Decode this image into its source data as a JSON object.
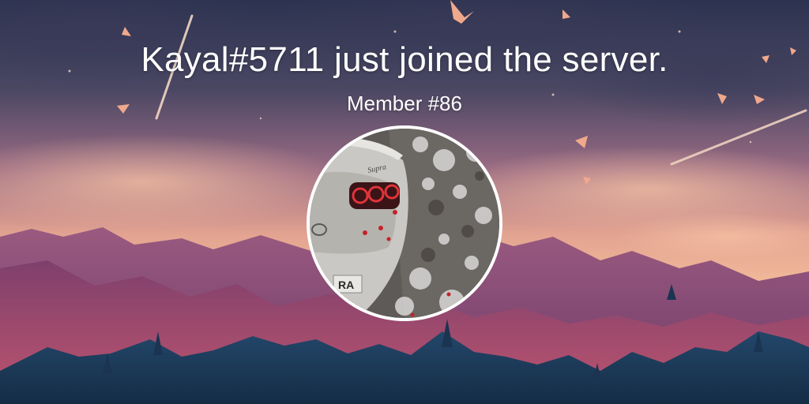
{
  "welcome": {
    "title": "Kayal#5711 just joined the server.",
    "member_line": "Member #86"
  },
  "avatar": {
    "depicts": "car-rear-in-snow",
    "icon": "avatar-image",
    "car_text": "Supra",
    "plate_text": "RA"
  },
  "colors": {
    "sky_top": "#2f3550",
    "sky_mid": "#8a5f7e",
    "sky_glow": "#e8a792",
    "mountain_far": "#8a4e78",
    "mountain_mid": "#6e3a66",
    "mountain_near": "#1c3a5a",
    "text": "#ffffff",
    "ring": "#ffffff",
    "taillight": "#d4262c"
  }
}
